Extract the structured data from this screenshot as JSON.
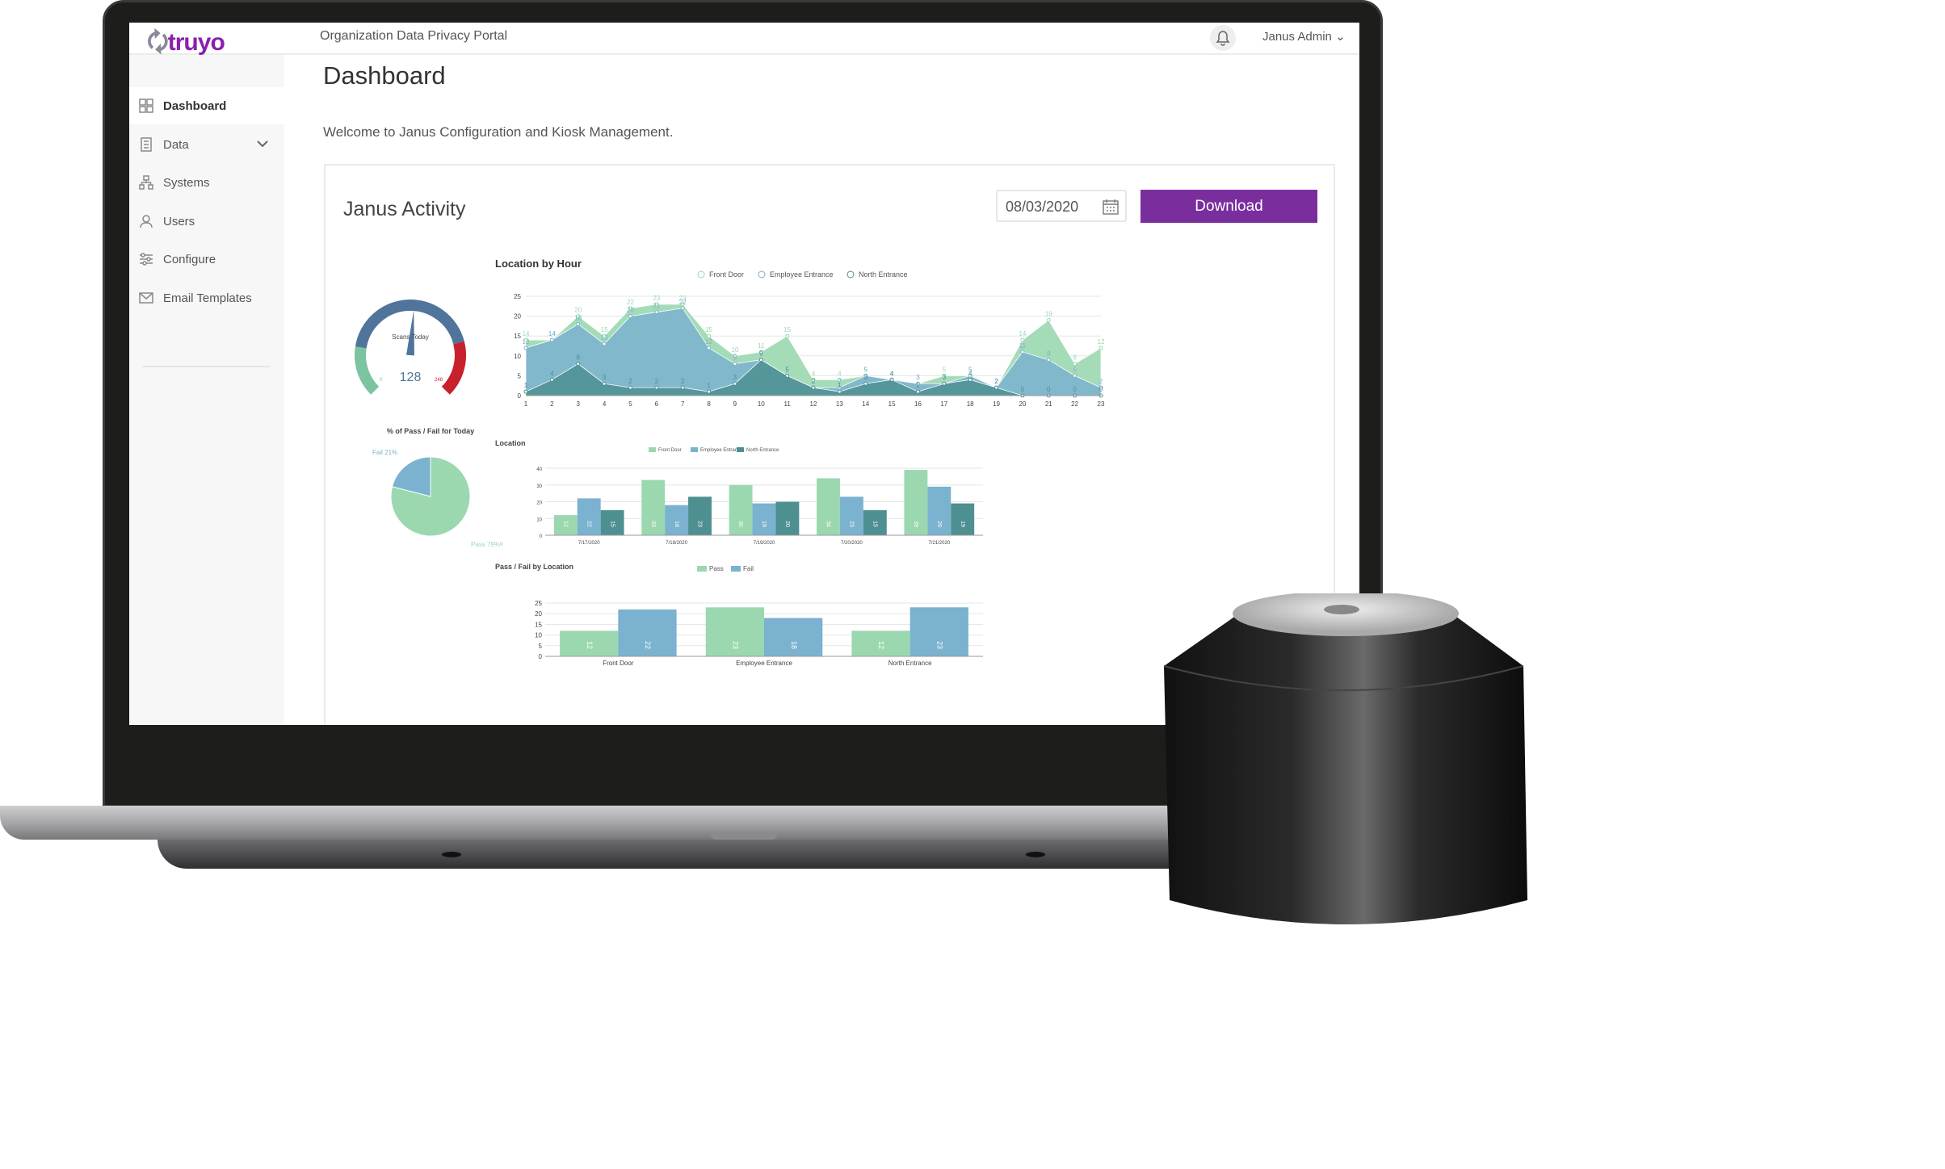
{
  "app": {
    "logo": "truyo",
    "portal_title": "Organization Data Privacy Portal",
    "user": "Janus Admin",
    "notification_icon": "bell-icon"
  },
  "sidebar": {
    "items": [
      {
        "label": "Dashboard",
        "icon": "grid-icon",
        "active": true
      },
      {
        "label": "Data",
        "icon": "document-icon",
        "expandable": true
      },
      {
        "label": "Systems",
        "icon": "hierarchy-icon"
      },
      {
        "label": "Users",
        "icon": "user-icon"
      },
      {
        "label": "Configure",
        "icon": "sliders-icon"
      },
      {
        "label": "Email Templates",
        "icon": "mail-icon"
      }
    ]
  },
  "page": {
    "title": "Dashboard",
    "subtitle": "Welcome to Janus Configuration and Kiosk Management."
  },
  "card": {
    "title": "Janus Activity",
    "date_value": "08/03/2020",
    "download_label": "Download"
  },
  "colors": {
    "accent": "#7a2e9e",
    "front_door": "#9bd8b0",
    "employee_entrance": "#7ab2cf",
    "north_entrance": "#4e8f92",
    "gauge_red": "#c8202c",
    "gauge_blue": "#50749a",
    "gauge_green": "#7cc4a0"
  },
  "chart_data": [
    {
      "type": "gauge",
      "label": "Scans Today",
      "value": 128,
      "min": 0,
      "max": 248
    },
    {
      "type": "pie",
      "title": "% of Pass / Fail for Today",
      "slices": [
        {
          "name": "Fail",
          "value": 21,
          "label": "Fail 21%"
        },
        {
          "name": "Pass",
          "value": 79,
          "label": "Pass 79%%"
        }
      ]
    },
    {
      "type": "area",
      "title": "Location by Hour",
      "x": [
        1,
        2,
        3,
        4,
        5,
        6,
        7,
        8,
        9,
        10,
        11,
        12,
        13,
        14,
        15,
        16,
        17,
        18,
        19,
        20,
        21,
        22,
        23
      ],
      "ylim": [
        0,
        25
      ],
      "yticks": [
        0,
        5,
        10,
        15,
        20,
        25
      ],
      "legend": "top",
      "grid": true,
      "series": [
        {
          "name": "Front Door",
          "values": [
            14,
            14,
            20,
            15,
            22,
            23,
            23,
            15,
            10,
            11,
            15,
            4,
            4,
            5,
            4,
            3,
            5,
            5,
            2,
            14,
            19,
            8,
            12
          ]
        },
        {
          "name": "Employee Entrance",
          "values": [
            12,
            14,
            18,
            13,
            20,
            21,
            22,
            12,
            8,
            9,
            5,
            2,
            2,
            5,
            4,
            3,
            3,
            5,
            2,
            11,
            9,
            5,
            2
          ]
        },
        {
          "name": "North Entrance",
          "values": [
            1,
            4,
            8,
            3,
            2,
            2,
            2,
            1,
            3,
            9,
            5,
            2,
            1,
            3,
            4,
            1,
            3,
            4,
            2,
            0,
            0,
            0,
            0
          ]
        }
      ]
    },
    {
      "type": "bar",
      "title": "Location",
      "categories": [
        "7/17/2020",
        "7/18/2020",
        "7/19/2020",
        "7/20/2020",
        "7/21/2020"
      ],
      "ylim": [
        0,
        40
      ],
      "yticks": [
        0,
        10,
        20,
        30,
        40
      ],
      "legend": "top",
      "grid": true,
      "series": [
        {
          "name": "Front Door",
          "values": [
            12,
            33,
            30,
            34,
            39
          ]
        },
        {
          "name": "Employee Entrance",
          "values": [
            22,
            18,
            19,
            23,
            29
          ]
        },
        {
          "name": "North Entrance",
          "values": [
            15,
            23,
            20,
            15,
            19
          ]
        }
      ]
    },
    {
      "type": "bar",
      "title": "Pass / Fail by Location",
      "categories": [
        "Front Door",
        "Employee Entrance",
        "North Entrance"
      ],
      "ylim": [
        0,
        25
      ],
      "yticks": [
        0,
        5,
        10,
        15,
        20,
        25
      ],
      "legend": "top",
      "grid": true,
      "series": [
        {
          "name": "Pass",
          "values": [
            12,
            23,
            12
          ]
        },
        {
          "name": "Fail",
          "values": [
            22,
            18,
            23
          ]
        }
      ]
    }
  ]
}
